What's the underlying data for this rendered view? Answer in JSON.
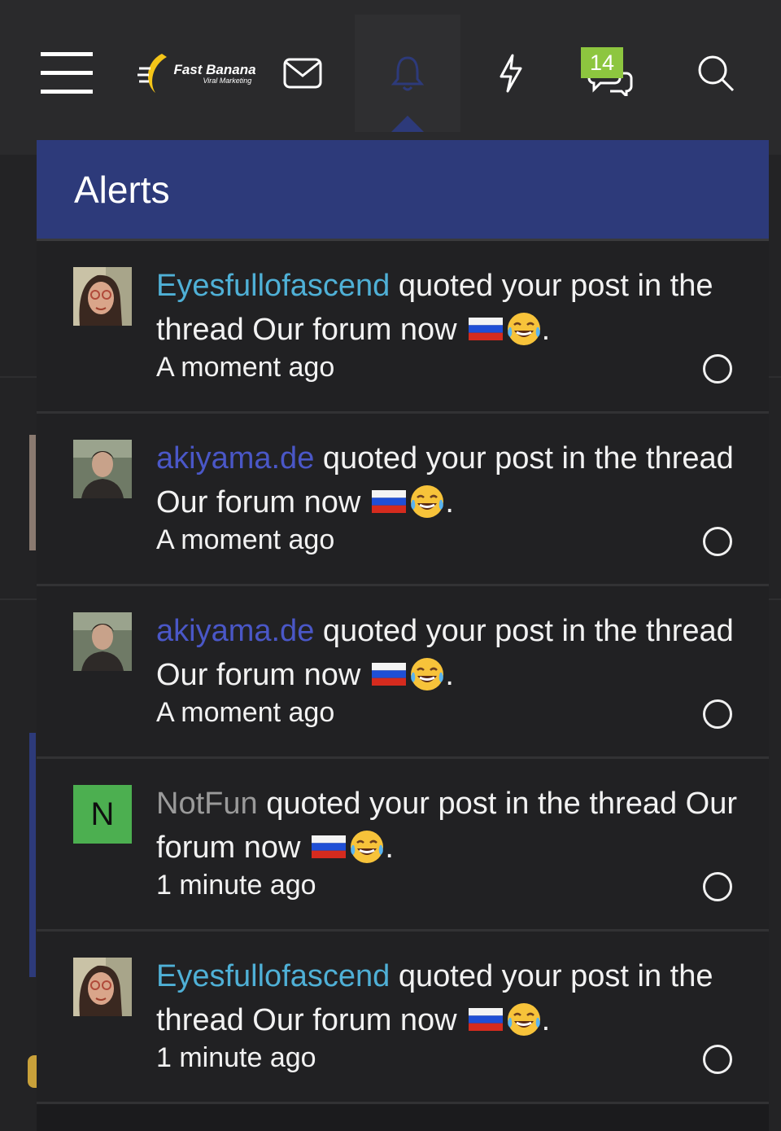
{
  "nav": {
    "logo_text": "Fast Banana",
    "logo_subtext": "Viral Marketing",
    "conversations_badge": "14",
    "icons": [
      "menu-icon",
      "mail-icon",
      "bell-icon",
      "bolt-icon",
      "chat-icon",
      "search-icon"
    ],
    "accent_color": "#2d3a7a"
  },
  "popup": {
    "title": "Alerts",
    "alerts": [
      {
        "user": "Eyesfullofascend",
        "user_color": "#4fb0d6",
        "action": "quoted your post in the thread Our forum now",
        "time": "A moment ago",
        "avatar": "photo-woman"
      },
      {
        "user": "akiyama.de",
        "user_color": "#4a57c7",
        "action": "quoted your post in the thread Our forum now",
        "time": "A moment ago",
        "avatar": "photo-man"
      },
      {
        "user": "akiyama.de",
        "user_color": "#4a57c7",
        "action": "quoted your post in the thread Our forum now",
        "time": "A moment ago",
        "avatar": "photo-man"
      },
      {
        "user": "NotFun",
        "user_color": "#9a9a9a",
        "action": "quoted your post in the thread Our forum now",
        "time": "1 minute ago",
        "avatar": "N",
        "avatar_color": "#4caf50"
      },
      {
        "user": "Eyesfullofascend",
        "user_color": "#4fb0d6",
        "action": "quoted your post in the thread Our forum now",
        "time": "1 minute ago",
        "avatar": "photo-woman"
      }
    ]
  }
}
